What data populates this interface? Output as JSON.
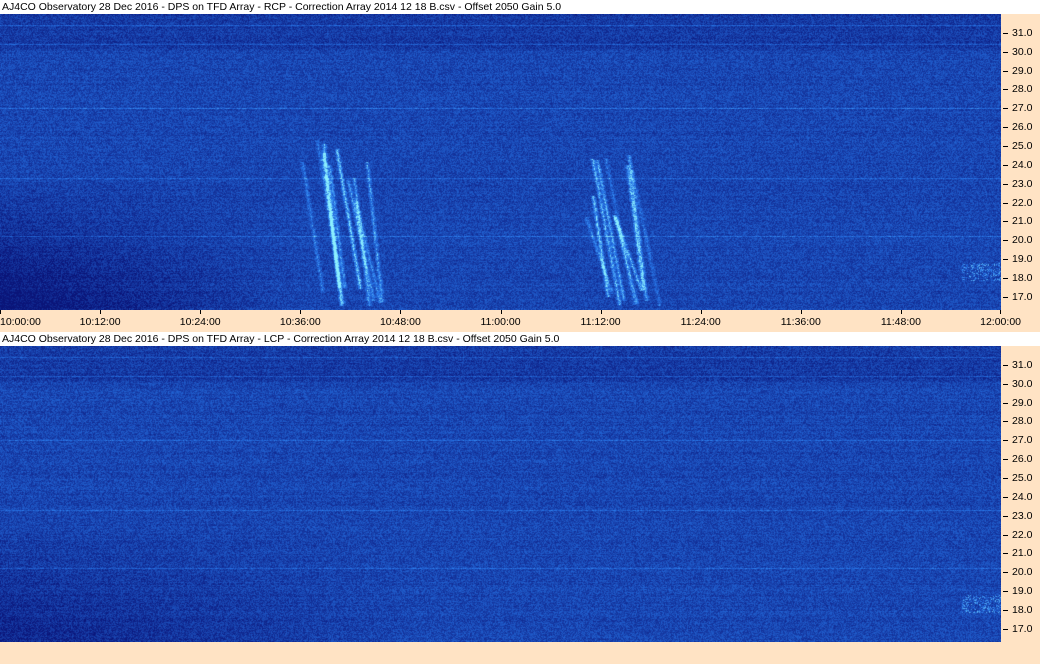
{
  "panels": [
    {
      "title": "AJ4CO Observatory 28 Dec 2016  -  DPS on TFD Array  -  RCP  -  Correction Array 2014 12 18 B.csv  -  Offset 2050  Gain 5.0",
      "polarization": "RCP"
    },
    {
      "title": "AJ4CO Observatory 28 Dec 2016  -  DPS on TFD Array  -  LCP  -  Correction Array 2014 12 18 B.csv  -  Offset 2050  Gain 5.0",
      "polarization": "LCP"
    }
  ],
  "chart_data": {
    "type": "heatmap",
    "x_axis": {
      "tick_labels": [
        "10:00:00",
        "10:12:00",
        "10:24:00",
        "10:36:00",
        "10:48:00",
        "11:00:00",
        "11:12:00",
        "11:24:00",
        "11:36:00",
        "11:48:00",
        "12:00:00"
      ],
      "range": [
        "10:00:00",
        "12:00:00"
      ]
    },
    "y_axis": {
      "tick_labels": [
        "31.0",
        "30.0",
        "29.0",
        "28.0",
        "27.0",
        "26.0",
        "25.0",
        "24.0",
        "23.0",
        "22.0",
        "21.0",
        "20.0",
        "19.0",
        "18.0",
        "17.0"
      ],
      "range": [
        16.3,
        32.0
      ],
      "position": "right"
    },
    "grid": false,
    "colors": {
      "background": "#1a4fd0",
      "dark": "#0a1f8a",
      "bright": "#6fd4ff",
      "axis_bg": "#ffe3c4"
    },
    "bursts": [
      {
        "panel": "RCP",
        "start": "10:36:00",
        "end": "10:47:00",
        "freq_range": [
          16.5,
          25.5
        ]
      },
      {
        "panel": "RCP",
        "start": "11:09:30",
        "end": "11:18:30",
        "freq_range": [
          16.5,
          24.8
        ]
      }
    ]
  }
}
